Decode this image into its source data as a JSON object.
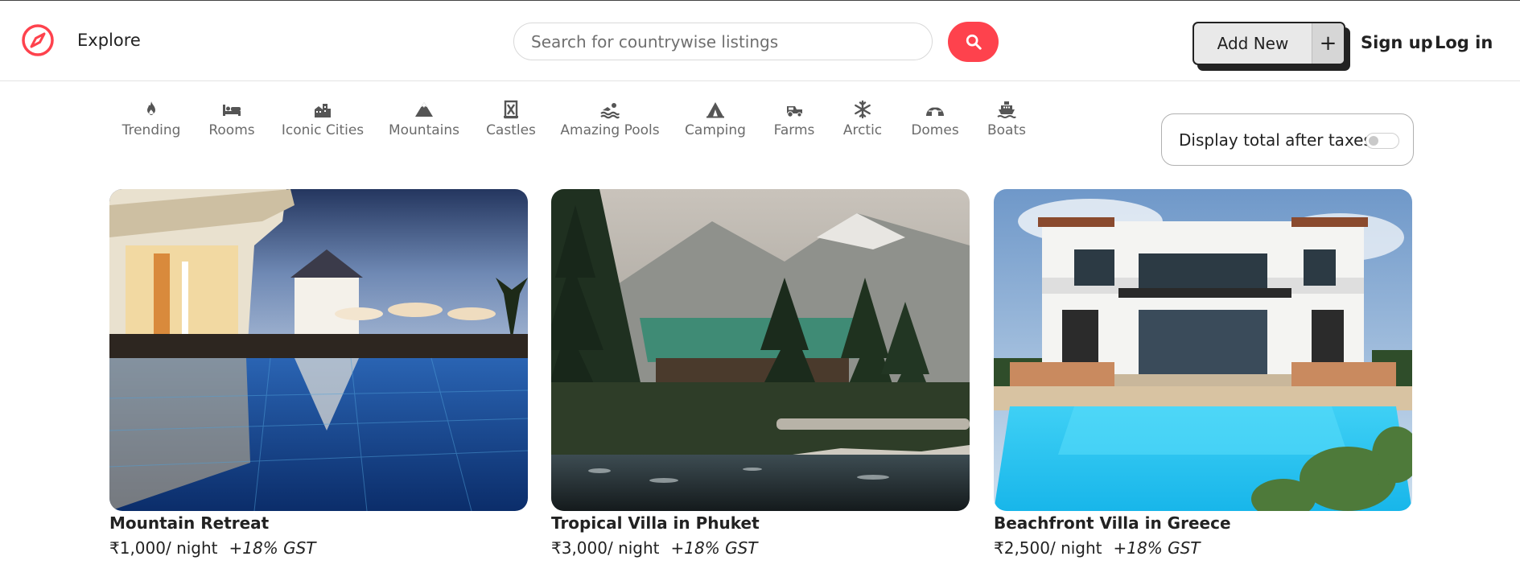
{
  "header": {
    "logo_icon": "compass-icon",
    "explore_label": "Explore",
    "search_placeholder": "Search for countrywise listings",
    "search_icon": "search-icon",
    "add_new_label": "Add New",
    "add_new_plus": "+",
    "signup_label": "Sign up",
    "login_label": "Log in"
  },
  "filters": [
    {
      "label": "Trending",
      "icon": "fire-icon"
    },
    {
      "label": "Rooms",
      "icon": "bed-icon"
    },
    {
      "label": "Iconic Cities",
      "icon": "city-icon"
    },
    {
      "label": "Mountains",
      "icon": "mountain-icon"
    },
    {
      "label": "Castles",
      "icon": "castle-icon"
    },
    {
      "label": "Amazing Pools",
      "icon": "swimmer-icon"
    },
    {
      "label": "Camping",
      "icon": "tent-icon"
    },
    {
      "label": "Farms",
      "icon": "tractor-icon"
    },
    {
      "label": "Arctic",
      "icon": "snowflake-icon"
    },
    {
      "label": "Domes",
      "icon": "igloo-icon"
    },
    {
      "label": "Boats",
      "icon": "ship-icon"
    }
  ],
  "tax_toggle": {
    "label": "Display total after taxes",
    "enabled": false
  },
  "listings": [
    {
      "title": "Mountain Retreat",
      "price": "₹1,000/ night",
      "tax_note": "+18% GST"
    },
    {
      "title": "Tropical Villa in Phuket",
      "price": "₹3,000/ night",
      "tax_note": "+18% GST"
    },
    {
      "title": "Beachfront Villa in Greece",
      "price": "₹2,500/ night",
      "tax_note": "+18% GST"
    }
  ],
  "colors": {
    "brand": "#fe424d",
    "text": "#222222",
    "muted": "#6b6b6b"
  }
}
